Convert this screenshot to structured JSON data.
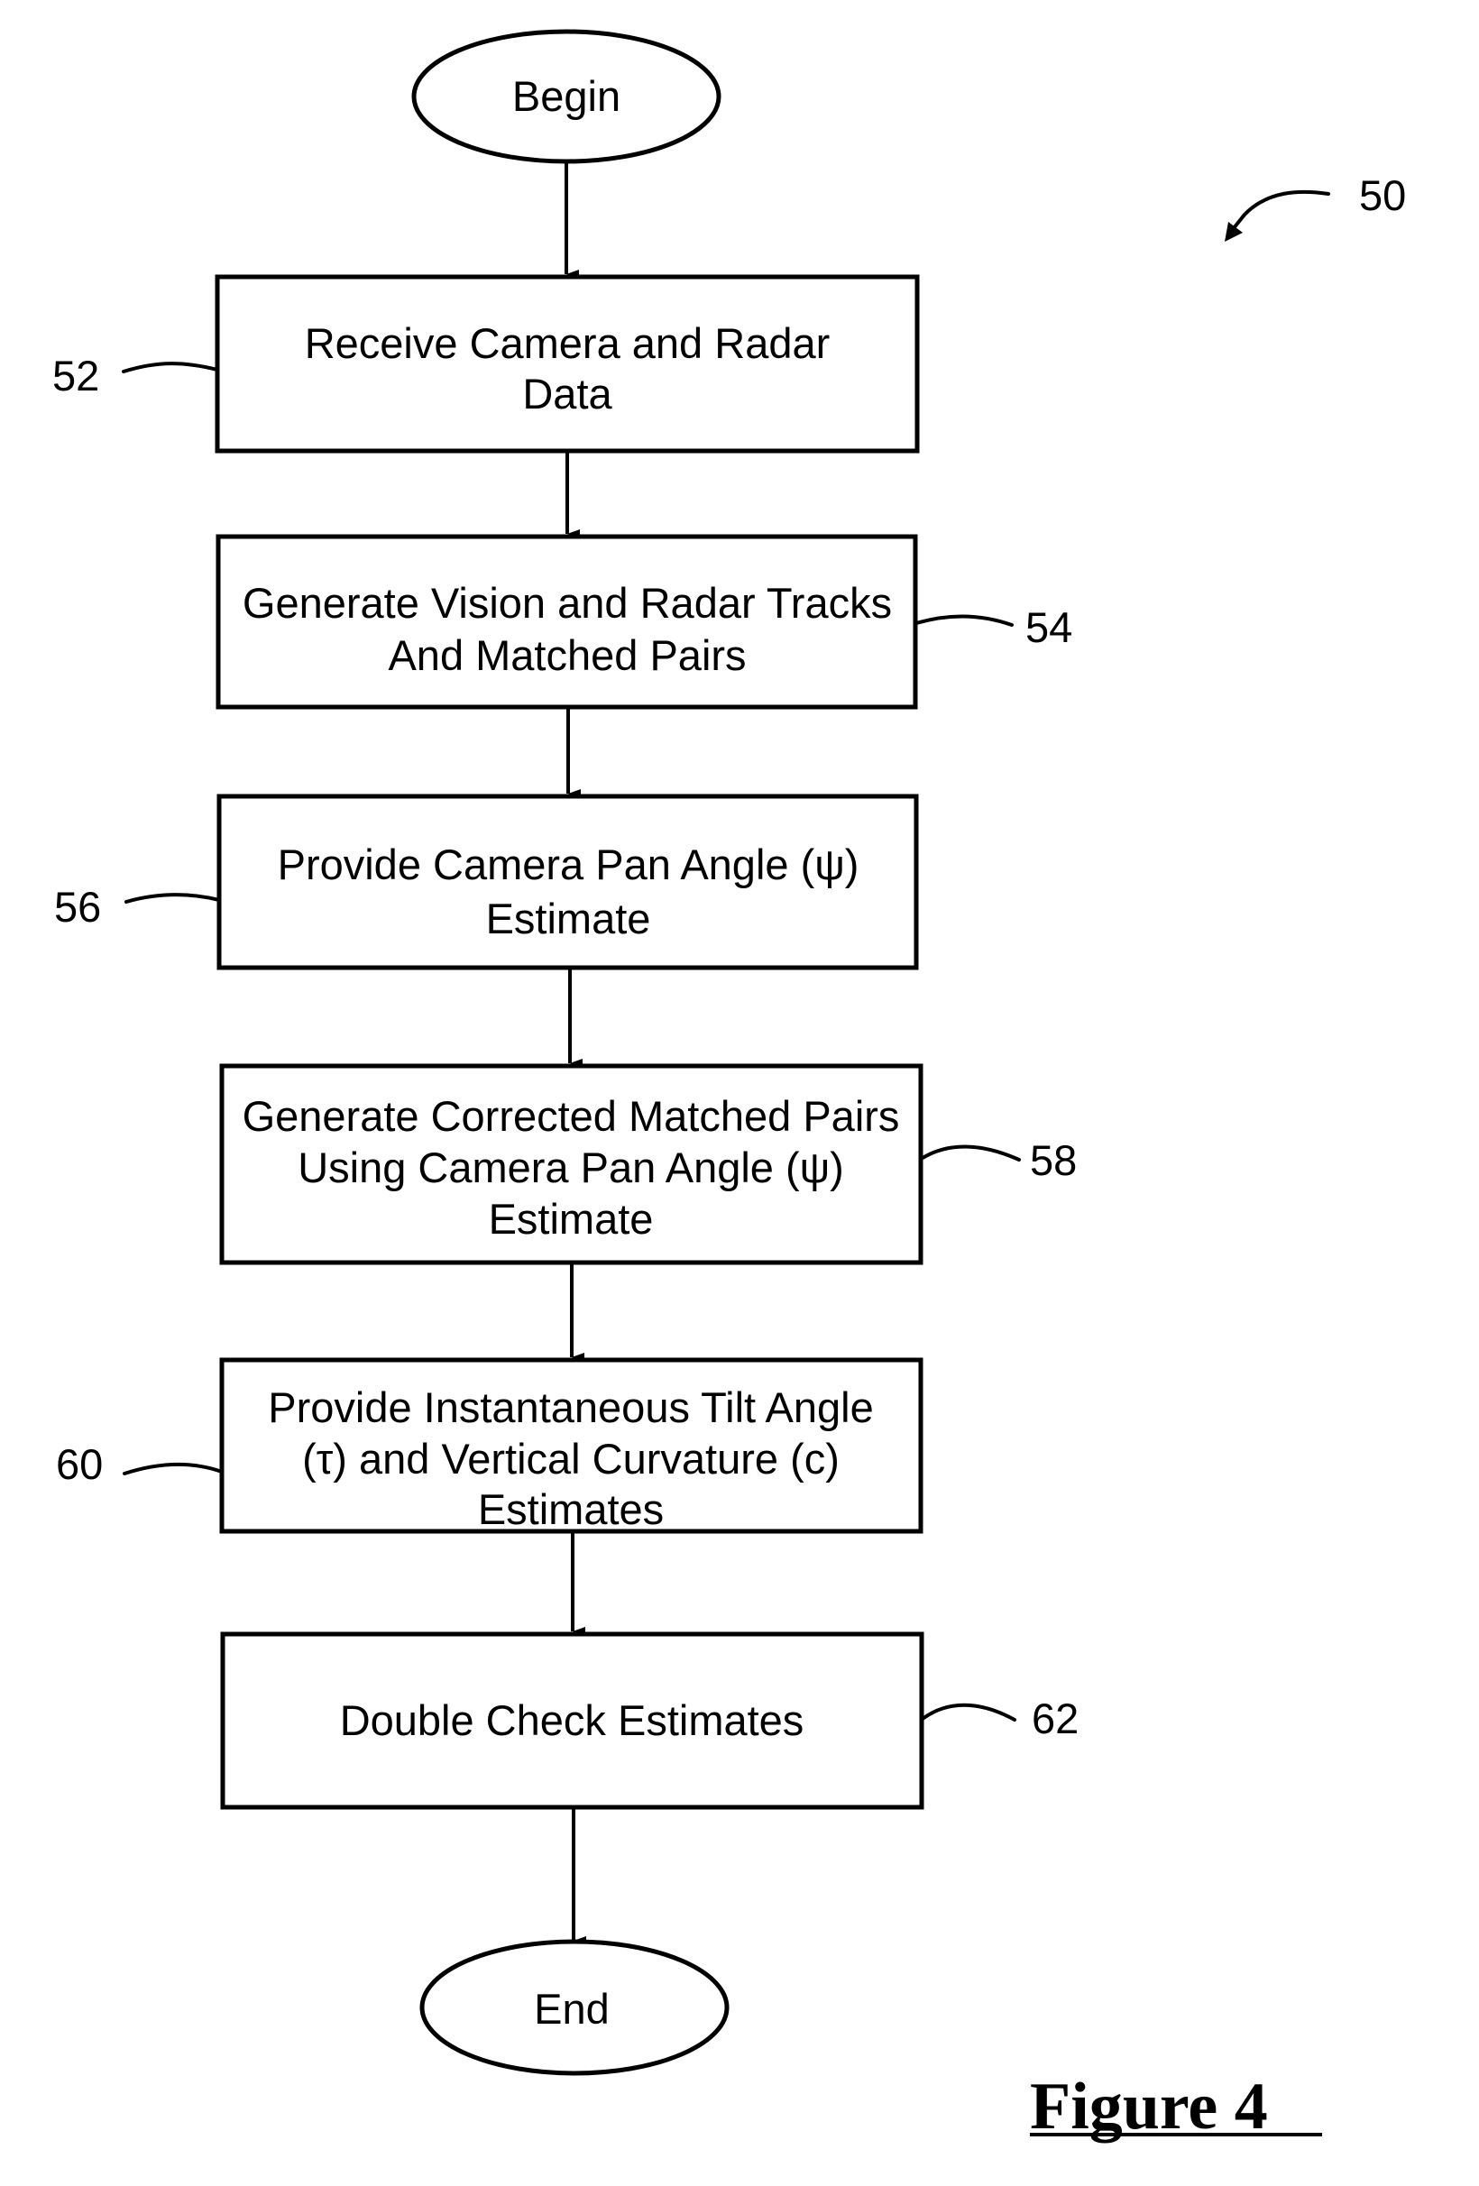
{
  "figure": {
    "title": "Figure 4",
    "reference": "50"
  },
  "start": {
    "label": "Begin"
  },
  "end": {
    "label": "End"
  },
  "steps": [
    {
      "ref": "52",
      "lines": [
        "Receive Camera and Radar",
        "Data"
      ]
    },
    {
      "ref": "54",
      "lines": [
        "Generate Vision and Radar Tracks",
        "And Matched Pairs"
      ]
    },
    {
      "ref": "56",
      "lines": [
        "Provide Camera Pan Angle (ψ)",
        "Estimate"
      ]
    },
    {
      "ref": "58",
      "lines": [
        "Generate Corrected Matched Pairs",
        "Using Camera Pan Angle (ψ)",
        "Estimate"
      ]
    },
    {
      "ref": "60",
      "lines": [
        "Provide Instantaneous Tilt Angle",
        "(τ) and Vertical Curvature (c)",
        "Estimates"
      ]
    },
    {
      "ref": "62",
      "lines": [
        "Double Check Estimates"
      ]
    }
  ],
  "colors": {
    "stroke": "#000000",
    "background": "#ffffff"
  }
}
